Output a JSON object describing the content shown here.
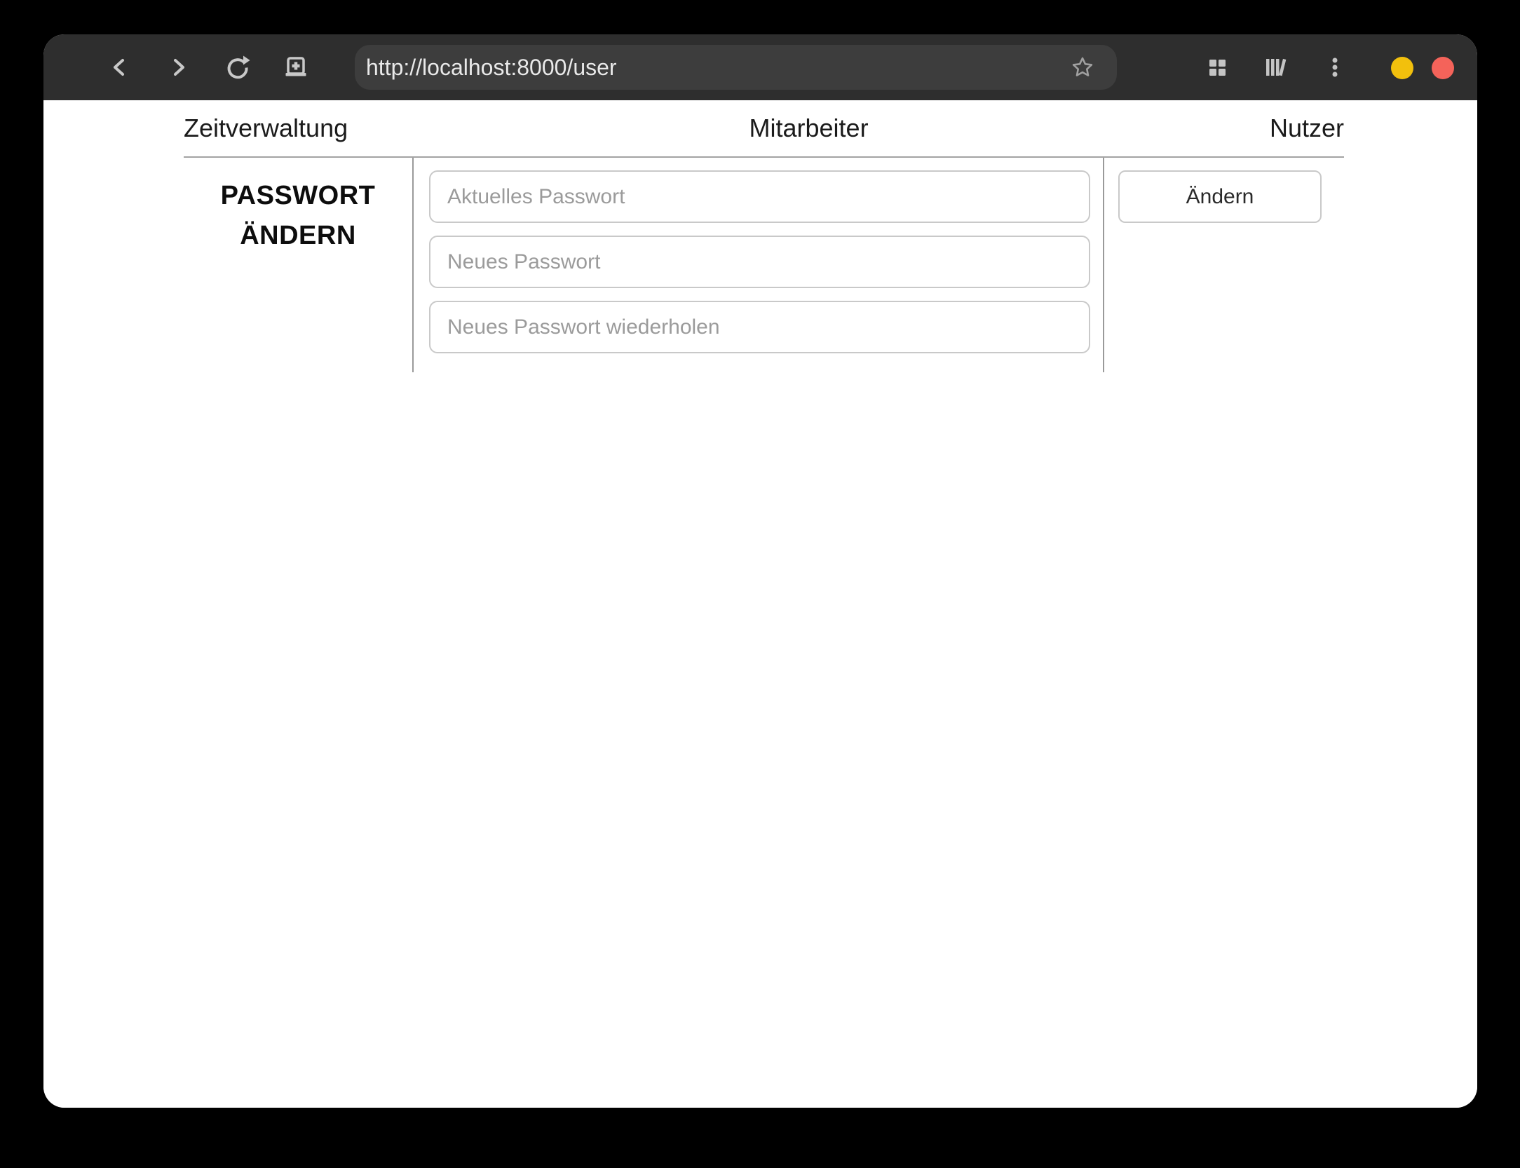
{
  "browser": {
    "url": "http://localhost:8000/user",
    "icons": {
      "back": "chevron-left",
      "forward": "chevron-right",
      "reload": "refresh-arrow",
      "new_tab": "tab-with-plus",
      "bookmark": "star-outline",
      "tab_overview": "grid-2x2",
      "library": "books",
      "menu": "kebab-vertical",
      "minimize": "yellow-circle",
      "close": "red-circle"
    },
    "window_button_colors": {
      "minimize": "#f2c00d",
      "close": "#f4635a"
    }
  },
  "colors": {
    "outer_background": "#000000",
    "toolbar_background": "#2e2e2e",
    "urlbar_background": "#3d3d3d",
    "page_background": "#ffffff",
    "divider": "#9a9a9a",
    "nav_rule": "#a3a3a3",
    "input_border": "#c9c9c9",
    "placeholder_text": "#9b9b9b",
    "icon": "#c8c8c8"
  },
  "nav": {
    "items": [
      {
        "label": "Zeitverwaltung"
      },
      {
        "label": "Mitarbeiter"
      },
      {
        "label": "Nutzer"
      }
    ]
  },
  "form": {
    "heading_line1": "PASSWORT",
    "heading_line2": "ÄNDERN",
    "fields": [
      {
        "placeholder": "Aktuelles Passwort"
      },
      {
        "placeholder": "Neues Passwort"
      },
      {
        "placeholder": "Neues Passwort wiederholen"
      }
    ],
    "submit_label": "Ändern"
  }
}
